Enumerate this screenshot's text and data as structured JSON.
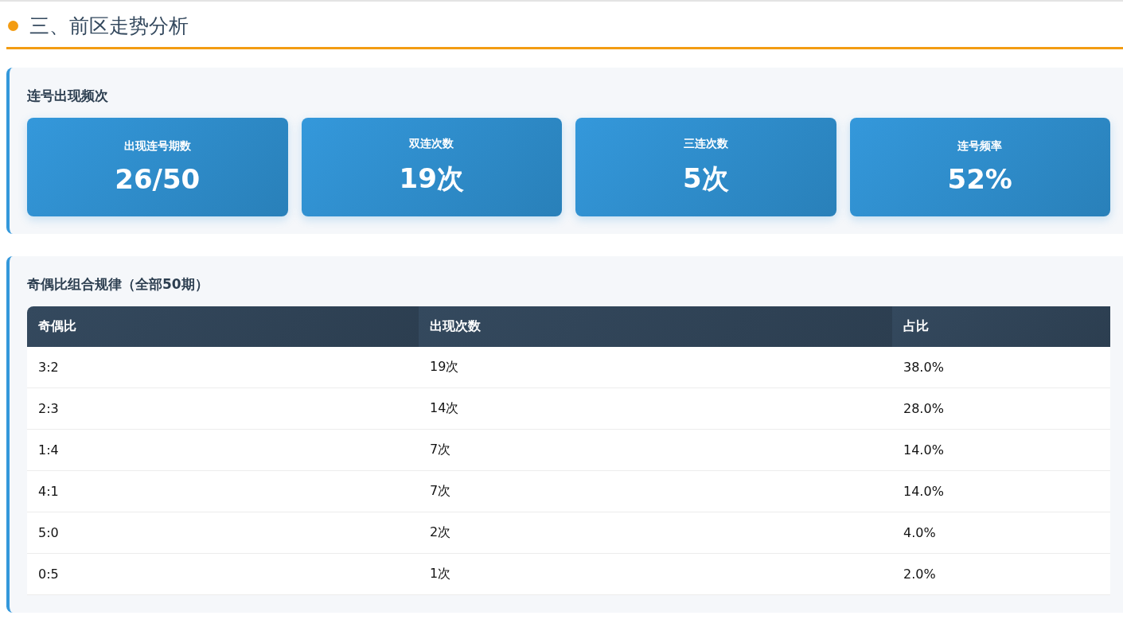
{
  "section": {
    "title": "三、前区走势分析"
  },
  "consecutive": {
    "title": "连号出现频次",
    "stats": [
      {
        "label": "出现连号期数",
        "value": "26/50"
      },
      {
        "label": "双连次数",
        "value": "19次"
      },
      {
        "label": "三连次数",
        "value": "5次"
      },
      {
        "label": "连号频率",
        "value": "52%"
      }
    ]
  },
  "parity": {
    "title": "奇偶比组合规律（全部50期）",
    "table": {
      "columns": [
        "奇偶比",
        "出现次数",
        "占比"
      ],
      "rows": [
        [
          "3:2",
          "19次",
          "38.0%"
        ],
        [
          "2:3",
          "14次",
          "28.0%"
        ],
        [
          "1:4",
          "7次",
          "14.0%"
        ],
        [
          "4:1",
          "7次",
          "14.0%"
        ],
        [
          "5:0",
          "2次",
          "4.0%"
        ],
        [
          "0:5",
          "1次",
          "2.0%"
        ]
      ]
    }
  }
}
